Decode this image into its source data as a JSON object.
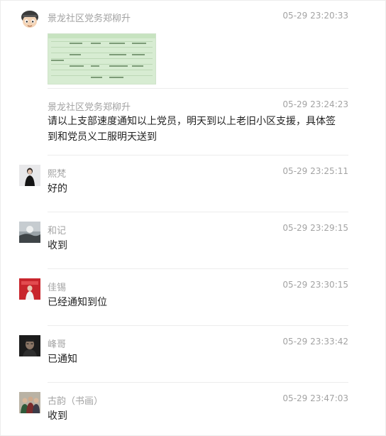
{
  "colors": {
    "background": "#ffffff",
    "sender_text": "#a3a3a3",
    "time_text": "#a3a3a3",
    "message_text": "#222222",
    "divider": "#ececec",
    "attachment_bg": "#d7ecd2"
  },
  "messages": [
    {
      "sender": "景龙社区党务郑柳升",
      "time": "05-29 23:20:33",
      "text": "",
      "avatar_icon": "cartoon-avatar-icon",
      "attachment": "spreadsheet-image"
    },
    {
      "sender": "景龙社区党务郑柳升",
      "time": "05-29 23:24:23",
      "text": "请以上支部速度通知以上党员，明天到以上老旧小区支援，具体签到和党员义工服明天送到",
      "avatar_icon": ""
    },
    {
      "sender": "熙梵",
      "time": "05-29 23:25:11",
      "text": "好的",
      "avatar_icon": "person-photo-icon"
    },
    {
      "sender": "和记",
      "time": "05-29 23:29:15",
      "text": "收到",
      "avatar_icon": "landscape-photo-icon"
    },
    {
      "sender": "佳锡",
      "time": "05-29 23:30:15",
      "text": "已经通知到位",
      "avatar_icon": "red-background-photo-icon"
    },
    {
      "sender": "峰哥",
      "time": "05-29 23:33:42",
      "text": "已通知",
      "avatar_icon": "dark-portrait-photo-icon"
    },
    {
      "sender": "古韵（书画）",
      "time": "05-29 23:47:03",
      "text": "收到",
      "avatar_icon": "group-photo-icon"
    }
  ]
}
